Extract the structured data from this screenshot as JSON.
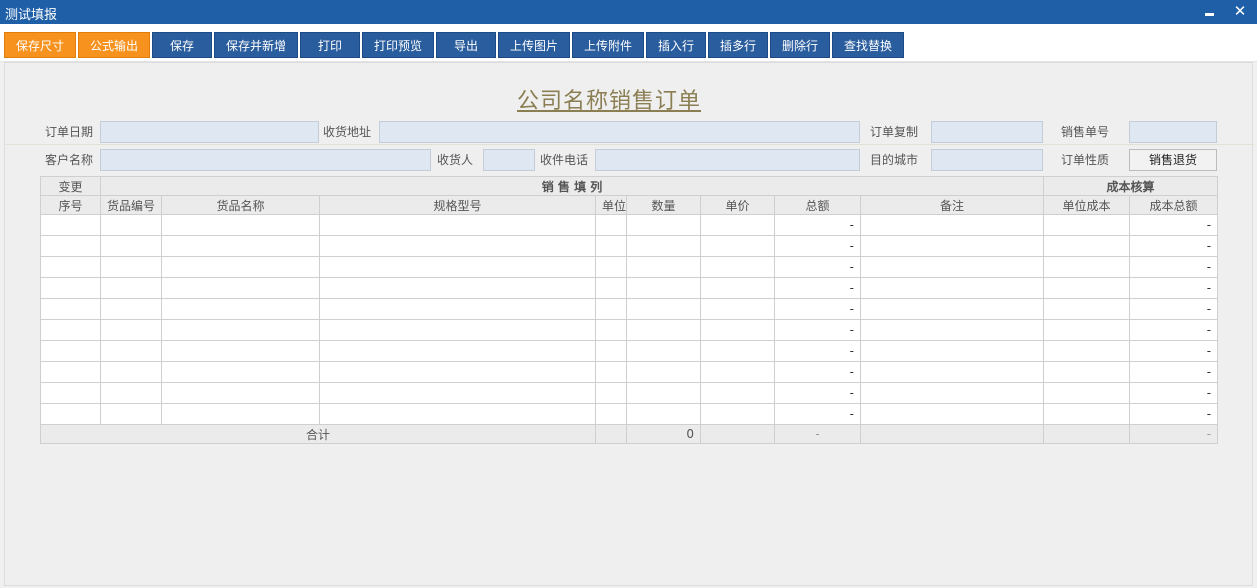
{
  "window": {
    "title": "测试填报",
    "close_label": "✕"
  },
  "toolbar": {
    "buttons": [
      "保存尺寸",
      "公式输出",
      "保存",
      "保存并新增",
      "打印",
      "打印预览",
      "导出",
      "上传图片",
      "上传附件",
      "插入行",
      "插多行",
      "删除行",
      "查找替换"
    ]
  },
  "form": {
    "title": "公司名称销售订单",
    "fields": {
      "order_date": {
        "label": "订单日期",
        "value": ""
      },
      "ship_address": {
        "label": "收货地址",
        "value": ""
      },
      "order_copy": {
        "label": "订单复制",
        "value": ""
      },
      "sales_no": {
        "label": "销售单号",
        "value": ""
      },
      "customer_name": {
        "label": "客户名称",
        "value": ""
      },
      "receiver": {
        "label": "收货人",
        "value": ""
      },
      "receiver_phone": {
        "label": "收件电话",
        "value": ""
      },
      "dest_city": {
        "label": "目的城市",
        "value": ""
      },
      "order_type": {
        "label": "订单性质",
        "value": "销售退货"
      }
    }
  },
  "table": {
    "group_change": "变更",
    "group_sales": "销 售 填 列",
    "group_cost": "成本核算",
    "columns": [
      "序号",
      "货品编号",
      "货品名称",
      "规格型号",
      "单位",
      "数量",
      "单价",
      "总额",
      "备注",
      "单位成本",
      "成本总额"
    ],
    "rows": [
      {
        "total": "-",
        "cost_total": "-"
      },
      {
        "total": "-",
        "cost_total": "-"
      },
      {
        "total": "-",
        "cost_total": "-"
      },
      {
        "total": "-",
        "cost_total": "-"
      },
      {
        "total": "-",
        "cost_total": "-"
      },
      {
        "total": "-",
        "cost_total": "-"
      },
      {
        "total": "-",
        "cost_total": "-"
      },
      {
        "total": "-",
        "cost_total": "-"
      },
      {
        "total": "-",
        "cost_total": "-"
      },
      {
        "total": "-",
        "cost_total": "-"
      }
    ],
    "footer": {
      "label": "合计",
      "qty": "0",
      "total": "-",
      "cost_total": "-"
    }
  }
}
